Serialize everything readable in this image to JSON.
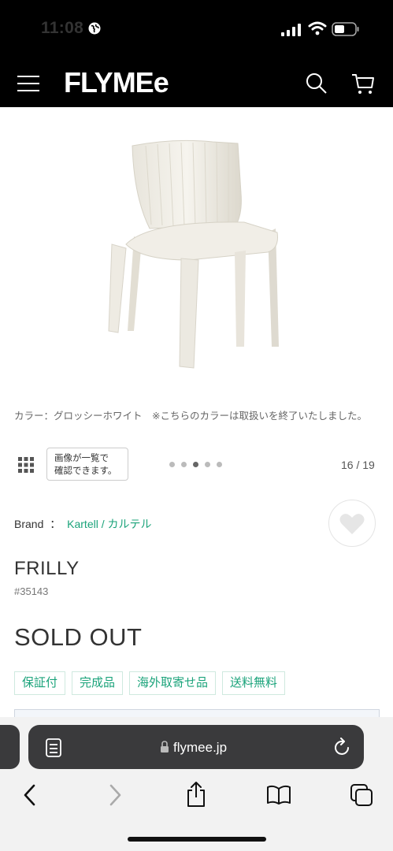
{
  "status_bar": {
    "time": "11:08"
  },
  "header": {
    "logo": "FLYMEe",
    "icons": [
      "menu-icon",
      "search-icon",
      "cart-icon"
    ]
  },
  "gallery": {
    "caption": "カラー：グロッシーホワイト　※こちらのカラーは取扱いを終了いたしました。",
    "grid_tip": [
      "画像が一覧で",
      "確認できます。"
    ],
    "dots_total": 5,
    "dots_active_index": 2,
    "counter": "16 / 19"
  },
  "product": {
    "brand_label": "Brand",
    "brand_sep": "：",
    "brand_link": "Kartell / カルテル",
    "name": "FRILLY",
    "number": "#35143",
    "status": "SOLD OUT",
    "tags": [
      "保証付",
      "完成品",
      "海外取寄せ品",
      "送料無料"
    ]
  },
  "safari": {
    "url": "flymee.jp"
  },
  "colors": {
    "accent": "#1aa37a",
    "header_bg": "#000000"
  }
}
